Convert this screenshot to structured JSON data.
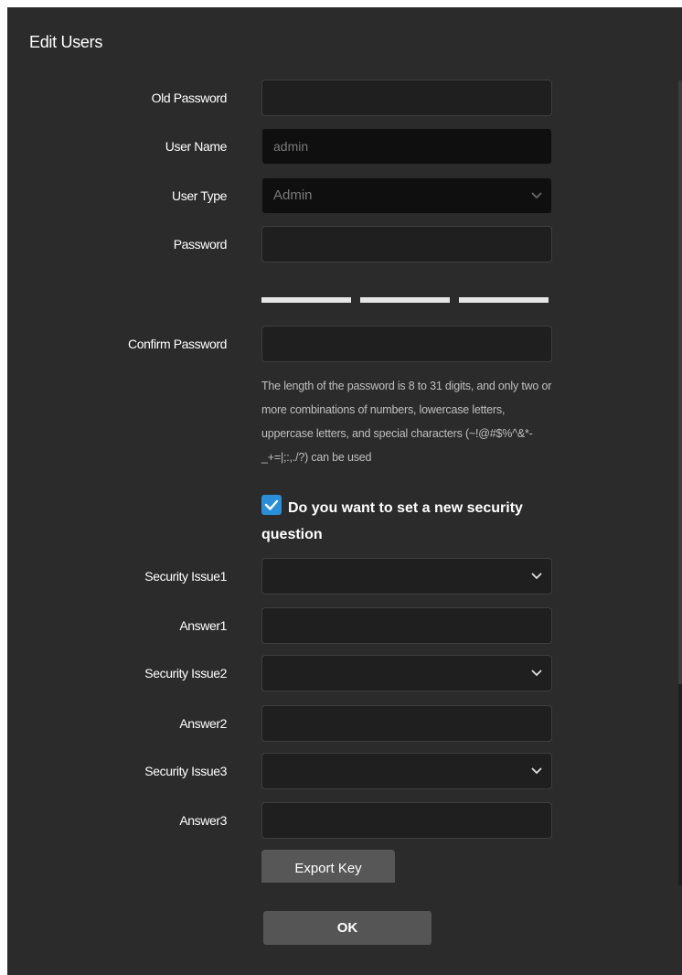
{
  "dialog": {
    "title": "Edit Users"
  },
  "form": {
    "old_password": {
      "label": "Old Password",
      "value": ""
    },
    "user_name": {
      "label": "User Name",
      "value": "admin"
    },
    "user_type": {
      "label": "User Type",
      "selected": "Admin"
    },
    "password": {
      "label": "Password",
      "value": ""
    },
    "confirm_password": {
      "label": "Confirm Password",
      "value": ""
    },
    "password_hint": "The length of the password is 8 to 31 digits, and only two or more combinations of numbers, lowercase letters, uppercase letters, and special characters (~!@#$%^&*-_+=|;:,./?) can be used",
    "security_checkbox": {
      "checked": true,
      "label_line1": "Do you want to set a new security",
      "label_line2": "question"
    },
    "security_issue1": {
      "label": "Security Issue1",
      "selected": ""
    },
    "answer1": {
      "label": "Answer1",
      "value": ""
    },
    "security_issue2": {
      "label": "Security Issue2",
      "selected": ""
    },
    "answer2": {
      "label": "Answer2",
      "value": ""
    },
    "security_issue3": {
      "label": "Security Issue3",
      "selected": ""
    },
    "answer3": {
      "label": "Answer3",
      "value": ""
    }
  },
  "buttons": {
    "export_key": "Export Key",
    "ok": "OK"
  },
  "colors": {
    "dialog_bg": "#2b2b2b",
    "accent": "#2a8fd8"
  }
}
